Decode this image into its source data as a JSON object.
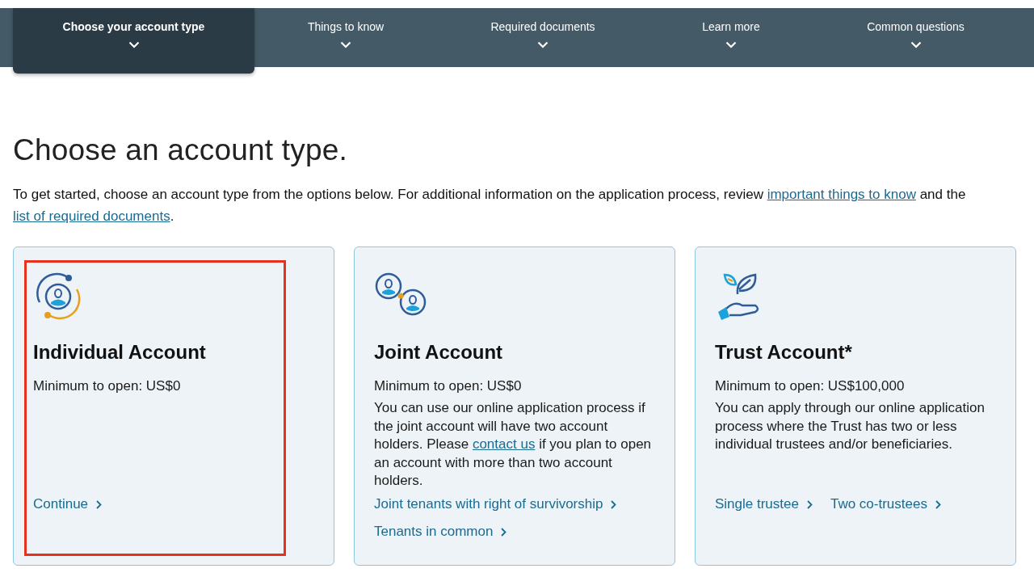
{
  "nav": {
    "tabs": [
      {
        "label": "Choose your account type",
        "selected": true
      },
      {
        "label": "Things to know",
        "selected": false
      },
      {
        "label": "Required documents",
        "selected": false
      },
      {
        "label": "Learn more",
        "selected": false
      },
      {
        "label": "Common questions",
        "selected": false
      }
    ]
  },
  "heading": "Choose an account type.",
  "intro": {
    "text": "To get started, choose an account type from the options below. For additional information on the application process, review ",
    "link1": "important things to know",
    "middle": " and the ",
    "link2": "list of required documents",
    "end": "."
  },
  "cards": [
    {
      "kind": "individual",
      "highlighted": true,
      "title": "Individual Account",
      "minimum": "Minimum to open: US$0",
      "links": [
        "Continue"
      ]
    },
    {
      "kind": "joint",
      "highlighted": false,
      "title": "Joint Account",
      "minimum": "Minimum to open: US$0",
      "description": [
        {
          "text": "You can use our online application process if the joint account will have two account holders. Please "
        },
        {
          "link": "contact us"
        },
        {
          "text": " if you plan to open an account with more than two account holders."
        }
      ],
      "links": [
        "Joint tenants with right of survivorship",
        "Tenants in common"
      ]
    },
    {
      "kind": "trust",
      "highlighted": false,
      "title": "Trust Account*",
      "minimum": "Minimum to open: US$100,000",
      "description": [
        {
          "text": "You can apply through our online application process where the Trust has two or less individual trustees and/or beneficiaries."
        }
      ],
      "links": [
        "Single trustee",
        "Two co-trustees"
      ]
    }
  ]
}
